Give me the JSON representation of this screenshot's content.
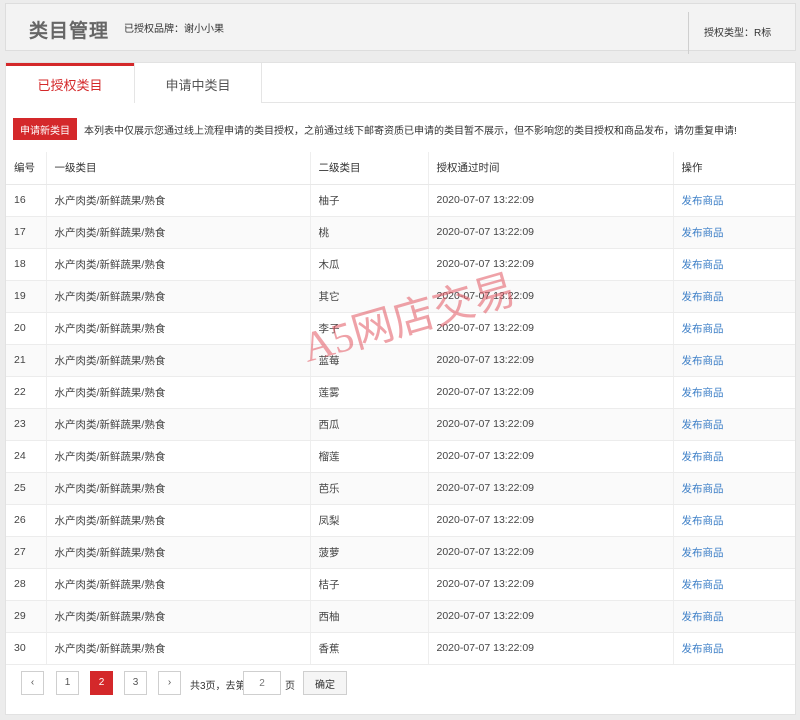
{
  "header": {
    "title": "类目管理",
    "brand": "已授权品牌：谢小小果",
    "auth_type": "授权类型：R标"
  },
  "tabs": [
    {
      "label": "已授权类目",
      "active": true
    },
    {
      "label": "申请中类目",
      "active": false
    }
  ],
  "apply_button": "申请新类目",
  "notice": "本列表中仅展示您通过线上流程申请的类目授权，之前通过线下邮寄资质已申请的类目暂不展示，但不影响您的类目授权和商品发布，请勿重复申请!",
  "table": {
    "columns": [
      "编号",
      "一级类目",
      "二级类目",
      "授权通过时间",
      "操作"
    ],
    "rows": [
      {
        "id": "16",
        "level1": "水产肉类/新鲜蔬果/熟食",
        "level2": "柚子",
        "time": "2020-07-07 13:22:09",
        "action": "发布商品"
      },
      {
        "id": "17",
        "level1": "水产肉类/新鲜蔬果/熟食",
        "level2": "桃",
        "time": "2020-07-07 13:22:09",
        "action": "发布商品"
      },
      {
        "id": "18",
        "level1": "水产肉类/新鲜蔬果/熟食",
        "level2": "木瓜",
        "time": "2020-07-07 13:22:09",
        "action": "发布商品"
      },
      {
        "id": "19",
        "level1": "水产肉类/新鲜蔬果/熟食",
        "level2": "其它",
        "time": "2020-07-07 13:22:09",
        "action": "发布商品"
      },
      {
        "id": "20",
        "level1": "水产肉类/新鲜蔬果/熟食",
        "level2": "李子",
        "time": "2020-07-07 13:22:09",
        "action": "发布商品"
      },
      {
        "id": "21",
        "level1": "水产肉类/新鲜蔬果/熟食",
        "level2": "蓝莓",
        "time": "2020-07-07 13:22:09",
        "action": "发布商品"
      },
      {
        "id": "22",
        "level1": "水产肉类/新鲜蔬果/熟食",
        "level2": "莲雾",
        "time": "2020-07-07 13:22:09",
        "action": "发布商品"
      },
      {
        "id": "23",
        "level1": "水产肉类/新鲜蔬果/熟食",
        "level2": "西瓜",
        "time": "2020-07-07 13:22:09",
        "action": "发布商品"
      },
      {
        "id": "24",
        "level1": "水产肉类/新鲜蔬果/熟食",
        "level2": "榴莲",
        "time": "2020-07-07 13:22:09",
        "action": "发布商品"
      },
      {
        "id": "25",
        "level1": "水产肉类/新鲜蔬果/熟食",
        "level2": "芭乐",
        "time": "2020-07-07 13:22:09",
        "action": "发布商品"
      },
      {
        "id": "26",
        "level1": "水产肉类/新鲜蔬果/熟食",
        "level2": "凤梨",
        "time": "2020-07-07 13:22:09",
        "action": "发布商品"
      },
      {
        "id": "27",
        "level1": "水产肉类/新鲜蔬果/熟食",
        "level2": "菠萝",
        "time": "2020-07-07 13:22:09",
        "action": "发布商品"
      },
      {
        "id": "28",
        "level1": "水产肉类/新鲜蔬果/熟食",
        "level2": "桔子",
        "time": "2020-07-07 13:22:09",
        "action": "发布商品"
      },
      {
        "id": "29",
        "level1": "水产肉类/新鲜蔬果/熟食",
        "level2": "西柚",
        "time": "2020-07-07 13:22:09",
        "action": "发布商品"
      },
      {
        "id": "30",
        "level1": "水产肉类/新鲜蔬果/熟食",
        "level2": "香蕉",
        "time": "2020-07-07 13:22:09",
        "action": "发布商品"
      }
    ]
  },
  "pagination": {
    "prev_icon": "chevron-left-icon",
    "next_icon": "chevron-right-icon",
    "prev_glyph": "‹",
    "next_glyph": "›",
    "pages": [
      "1",
      "2",
      "3"
    ],
    "current_page": "2",
    "total_text": "共3页，去第",
    "input_value": "2",
    "page_suffix": "页",
    "confirm_label": "确定"
  },
  "watermark": "A5网店交易",
  "colors": {
    "accent_red": "#d4282a",
    "link_blue": "#3d7fc7"
  }
}
